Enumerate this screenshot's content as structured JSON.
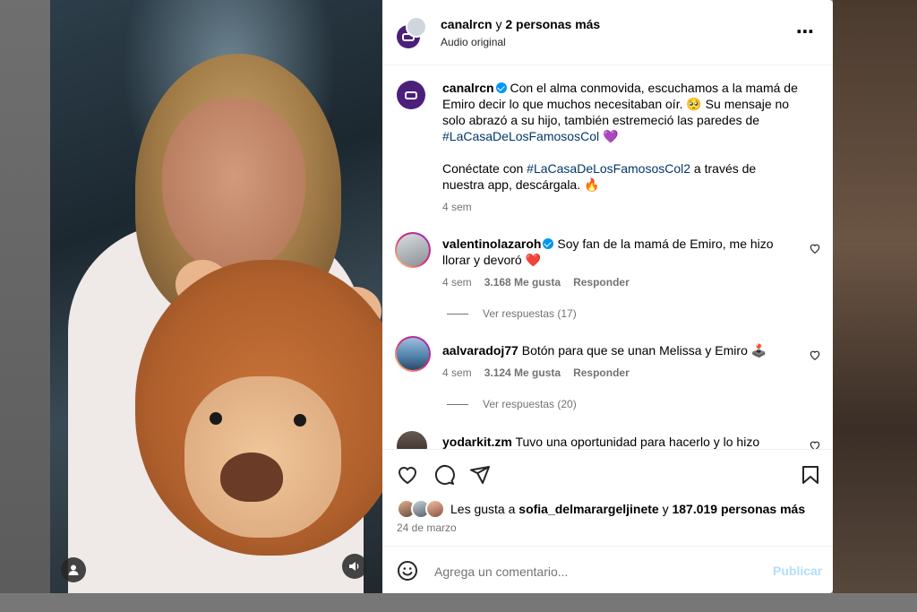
{
  "post": {
    "header": {
      "author": "canalrcn",
      "connector": " y ",
      "others": "2 personas más",
      "audio": "Audio original"
    },
    "caption": {
      "username": "canalrcn",
      "text_1": " Con el alma conmovida, escuchamos a la mamá de Emiro decir lo que muchos necesitaban oír. 🥺 Su mensaje no solo abrazó a su hijo, también estremeció las paredes de ",
      "hashtag_1": "#LaCasaDeLosFamososCol",
      "emoji_1": " 💜",
      "text_2": "Conéctate con ",
      "hashtag_2": "#LaCasaDeLosFamososCol2",
      "text_3": " a través de nuestra app, descárgala. 🔥",
      "time": "4 sem"
    },
    "comments": [
      {
        "username": "valentinolazaroh",
        "text": " Soy fan de la mamá de Emiro, me hizo llorar y devoró ❤️",
        "time": "4 sem",
        "likes": "3.168 Me gusta",
        "reply": "Responder",
        "view_replies": "Ver respuestas (17)"
      },
      {
        "username": "aalvaradoj77",
        "text": " Botón para que se unan Melissa y Emiro 🕹️",
        "time": "4 sem",
        "likes": "3.124 Me gusta",
        "reply": "Responder",
        "view_replies": "Ver respuestas (20)"
      },
      {
        "username": "yodarkit.zm",
        "text": " Tuvo una oportunidad para hacerlo y lo hizo"
      }
    ],
    "likes": {
      "prefix": "Les gusta a ",
      "user": "sofia_delmarargeljinete",
      "mid": " y ",
      "count": "187.019 personas más"
    },
    "date": "24 de marzo",
    "add_comment": {
      "placeholder": "Agrega un comentario...",
      "publish": "Publicar"
    }
  },
  "colors": {
    "link": "#00376b",
    "verified": "#0095f6",
    "publish_disabled": "#b2dffc",
    "brand_logo": "#4b1f7a"
  }
}
